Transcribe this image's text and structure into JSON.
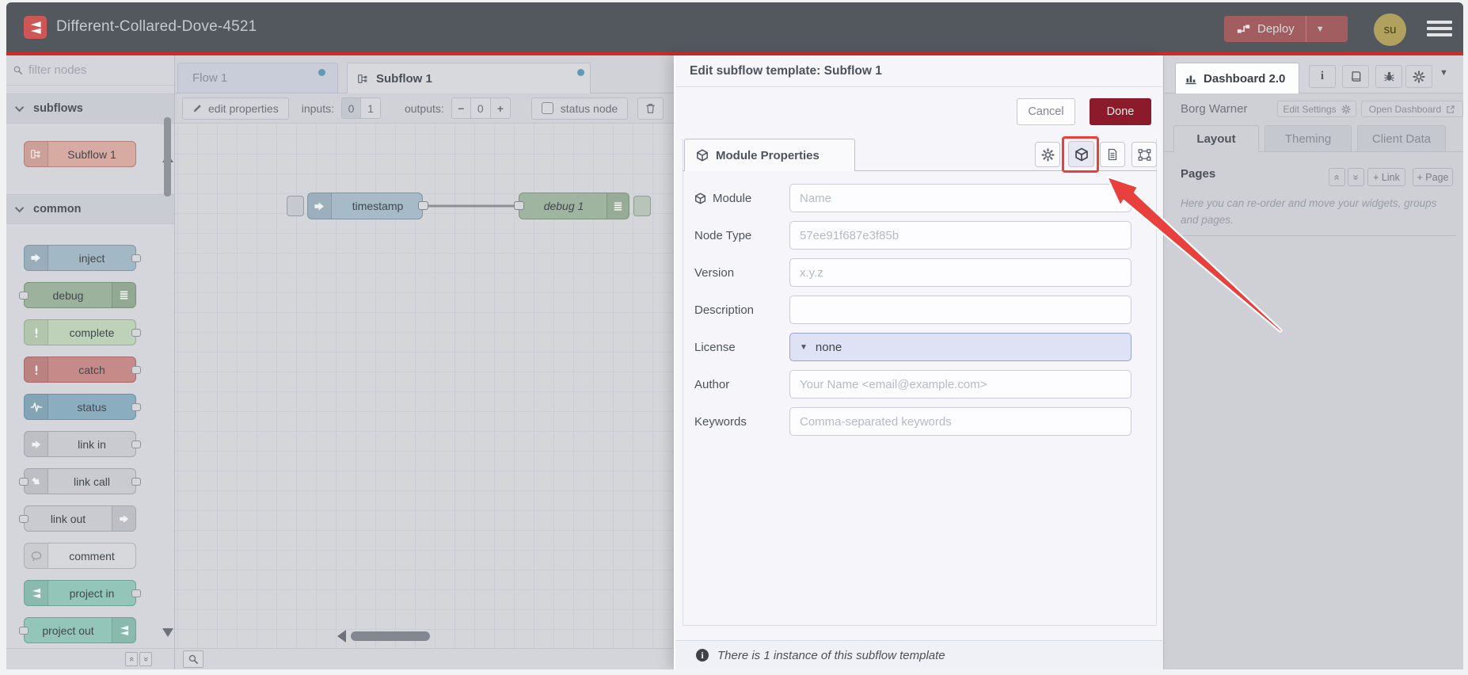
{
  "colors": {
    "accent_red_line": "#cf2b27",
    "header_bg": "#53575e",
    "deploy_button": "#a15d60",
    "done_button": "#8b1a2a",
    "annotation_red": "#e8403d",
    "tab_dot_blue": "#5e9ab8",
    "canvas_bg": "#d4d6da",
    "tray_bg": "#f6f6fa",
    "license_field_bg": "#dfe2f4",
    "subflow_node": "#d7aaa2",
    "inject_node": "#a3b8c5",
    "debug_node": "#9cb29c",
    "complete_node": "#bdd2b8",
    "catch_node": "#c68a89",
    "status_node": "#8aaebf",
    "link_node": "#c9cbd0",
    "comment_node": "#d6d8db",
    "project_node": "#93c5b9"
  },
  "header": {
    "title": "Different-Collared-Dove-4521",
    "deploy": "Deploy",
    "avatar": "su"
  },
  "palette": {
    "search_placeholder": "filter nodes",
    "category_subflows": "subflows",
    "category_common": "common",
    "nodes": [
      {
        "label": "Subflow 1"
      },
      {
        "label": "inject"
      },
      {
        "label": "debug"
      },
      {
        "label": "complete"
      },
      {
        "label": "catch"
      },
      {
        "label": "status"
      },
      {
        "label": "link in"
      },
      {
        "label": "link call"
      },
      {
        "label": "link out"
      },
      {
        "label": "comment"
      },
      {
        "label": "project in"
      },
      {
        "label": "project out"
      }
    ]
  },
  "workspace": {
    "tabs": [
      {
        "label": "Flow 1"
      },
      {
        "label": "Subflow 1"
      }
    ],
    "toolbar": {
      "edit_properties": "edit properties",
      "inputs_label": "inputs:",
      "input_zero": "0",
      "input_one": "1",
      "outputs_label": "outputs:",
      "minus": "−",
      "outputs_value": "0",
      "plus": "+",
      "status_node": "status node"
    },
    "canvas": {
      "inject_node": "timestamp",
      "debug_node": "debug 1"
    }
  },
  "tray": {
    "title": "Edit subflow template: Subflow 1",
    "cancel": "Cancel",
    "done": "Done",
    "tab_module_properties": "Module Properties",
    "fields": {
      "module": {
        "label": "Module",
        "placeholder": "Name"
      },
      "node_type": {
        "label": "Node Type",
        "placeholder": "57ee91f687e3f85b"
      },
      "version": {
        "label": "Version",
        "placeholder": "x.y.z"
      },
      "description": {
        "label": "Description",
        "placeholder": ""
      },
      "license": {
        "label": "License",
        "value": "none"
      },
      "author": {
        "label": "Author",
        "placeholder": "Your Name <email@example.com>"
      },
      "keywords": {
        "label": "Keywords",
        "placeholder": "Comma-separated keywords"
      }
    },
    "footer": "There is 1 instance of this subflow template"
  },
  "sidebar": {
    "active_tab": "Dashboard 2.0",
    "project_name": "Borg Warner",
    "edit_settings": "Edit Settings",
    "open_dashboard": "Open Dashboard",
    "tabs": [
      "Layout",
      "Theming",
      "Client Data"
    ],
    "pages": {
      "title": "Pages",
      "add_link": "+ Link",
      "add_page": "+ Page",
      "hint": "Here you can re-order and move your widgets, groups and pages."
    }
  }
}
